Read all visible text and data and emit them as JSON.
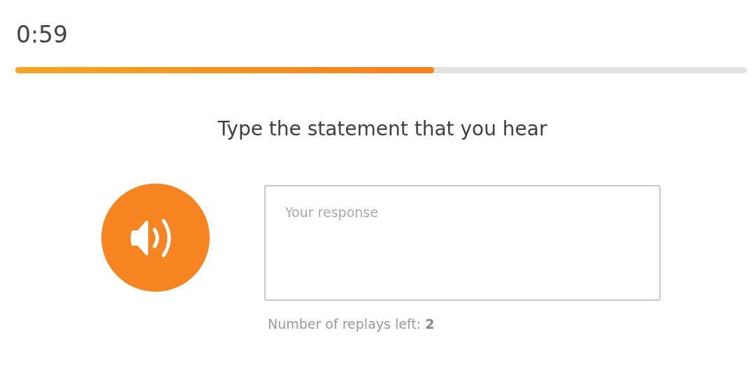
{
  "timer": "0:59",
  "progress": {
    "level": 0.573
  },
  "prompt": "Type the statement that you hear",
  "response": {
    "placeholder": "Your response"
  },
  "replays_note": "Number of replays left: **2**"
}
